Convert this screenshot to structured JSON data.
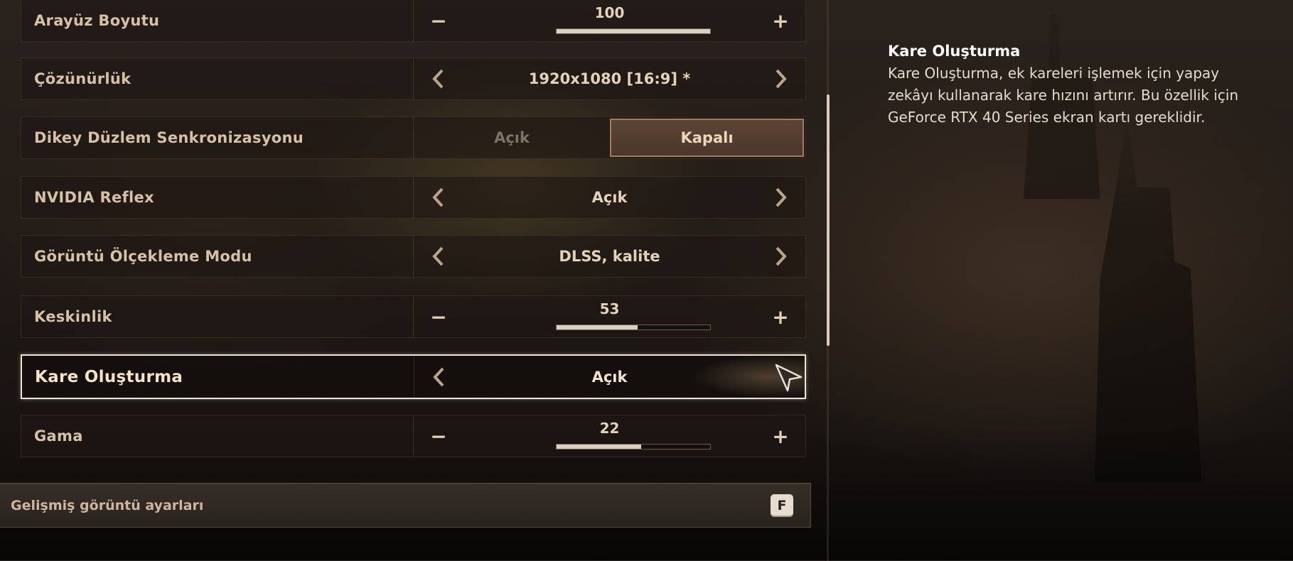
{
  "settings": {
    "rows": [
      {
        "label": "Arayüz Boyutu",
        "type": "slider",
        "value": "100",
        "fill_fraction": 1.0
      },
      {
        "label": "Çözünürlük",
        "type": "selector",
        "value": "1920x1080 [16:9] *"
      },
      {
        "label": "Dikey Düzlem Senkronizasyonu",
        "type": "toggle",
        "option_off": "Açık",
        "option_on": "Kapalı"
      },
      {
        "label": "NVIDIA Reflex",
        "type": "selector",
        "value": "Açık"
      },
      {
        "label": "Görüntü Ölçekleme Modu",
        "type": "selector",
        "value": "DLSS, kalite"
      },
      {
        "label": "Keskinlik",
        "type": "slider",
        "value": "53",
        "fill_fraction": 0.53
      },
      {
        "label": "Kare Oluşturma",
        "type": "selector",
        "value": "Açık",
        "selected": true
      },
      {
        "label": "Gama",
        "type": "slider",
        "value": "22",
        "fill_fraction": 0.55
      }
    ]
  },
  "controls": {
    "minus": "−",
    "plus": "+"
  },
  "advanced": {
    "label": "Gelişmiş görüntü ayarları",
    "key": "F"
  },
  "info": {
    "title": "Kare Oluşturma",
    "description": "Kare Oluşturma, ek kareleri işlemek için yapay zekâyı kullanarak kare hızını artırır. Bu özellik için GeForce RTX 40 Series ekran kartı gereklidir."
  },
  "icons": {
    "arrow_left": "chevron-left-icon",
    "arrow_right": "chevron-right-icon",
    "cursor": "mouse-cursor-icon"
  },
  "colors": {
    "label_text": "#d5c2a5",
    "value_text": "#e3d3b9",
    "selected_border": "#ece4d8",
    "toggle_active_bg": "#5a4434",
    "toggle_active_border": "#9d7e5e"
  }
}
